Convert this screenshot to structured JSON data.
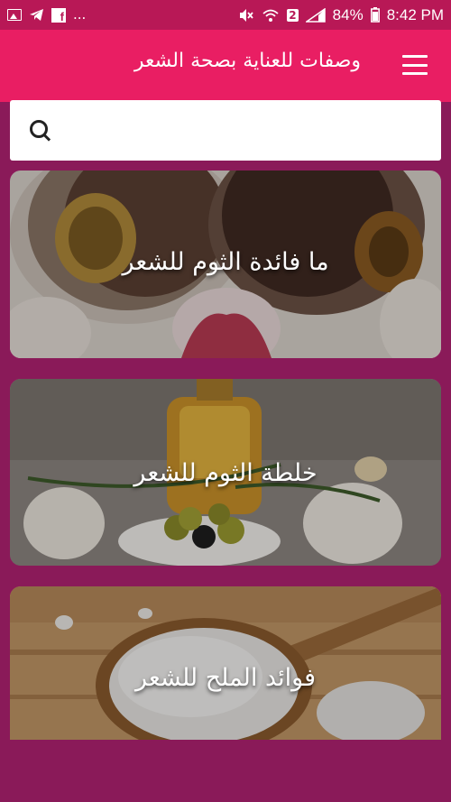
{
  "status_bar": {
    "icons_left": [
      "gallery-icon",
      "telegram-icon",
      "facebook-icon"
    ],
    "more": "...",
    "icons_right": [
      "mute-icon",
      "wifi-icon",
      "signal-icon"
    ],
    "sim_badge": "2",
    "battery": "84%",
    "time": "8:42 PM"
  },
  "app_bar": {
    "title": "وصفات للعناية بصحة الشعر",
    "menu_icon": "menu-icon"
  },
  "search": {
    "icon": "search-icon",
    "placeholder": "",
    "value": ""
  },
  "cards": [
    {
      "title": "ما فائدة الثوم للشعر"
    },
    {
      "title": "خلطة الثوم للشعر"
    },
    {
      "title": "فوائد الملح للشعر"
    }
  ],
  "colors": {
    "status_bar": "#b81856",
    "app_bar": "#e91e63",
    "background": "#8a1a59"
  }
}
